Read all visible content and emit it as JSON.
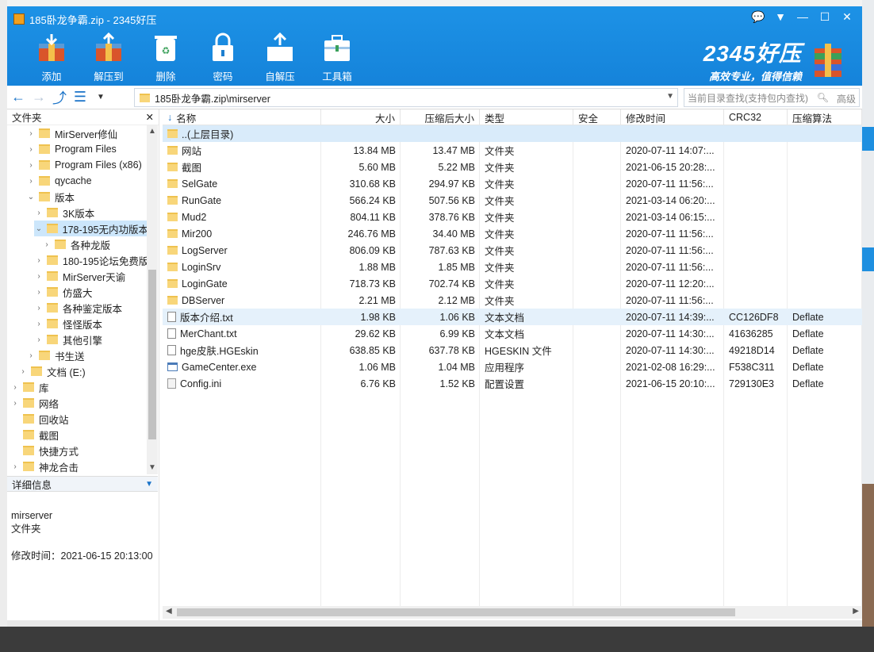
{
  "window": {
    "title": "185卧龙争霸.zip - 2345好压"
  },
  "toolbar": [
    {
      "label": "添加"
    },
    {
      "label": "解压到"
    },
    {
      "label": "删除"
    },
    {
      "label": "密码"
    },
    {
      "label": "自解压"
    },
    {
      "label": "工具箱"
    }
  ],
  "brand": {
    "name": "2345好压",
    "slogan": "高效专业，值得信赖"
  },
  "address": {
    "path": "185卧龙争霸.zip\\mirserver"
  },
  "search": {
    "placeholder": "当前目录查找(支持包内查找)",
    "advanced": "高级"
  },
  "left_pane": {
    "title": "文件夹",
    "tree": [
      {
        "label": "MirServer修仙",
        "level": 3,
        "arrow": "›"
      },
      {
        "label": "Program Files",
        "level": 3,
        "arrow": "›"
      },
      {
        "label": "Program Files (x86)",
        "level": 3,
        "arrow": "›"
      },
      {
        "label": "qycache",
        "level": 3,
        "arrow": "›"
      },
      {
        "label": "版本",
        "level": 3,
        "arrow": "⌄"
      },
      {
        "label": "3K版本",
        "level": 4,
        "arrow": "›"
      },
      {
        "label": "178-195无内功版本",
        "level": 4,
        "arrow": "⌄",
        "selected": true
      },
      {
        "label": "各种龙版",
        "level": 5,
        "arrow": "›"
      },
      {
        "label": "180-195论坛免费版",
        "level": 4,
        "arrow": "›"
      },
      {
        "label": "MirServer天谕",
        "level": 4,
        "arrow": "›"
      },
      {
        "label": "仿盛大",
        "level": 4,
        "arrow": "›"
      },
      {
        "label": "各种鉴定版本",
        "level": 4,
        "arrow": "›"
      },
      {
        "label": "怪怪版本",
        "level": 4,
        "arrow": "›"
      },
      {
        "label": "其他引擎",
        "level": 4,
        "arrow": "›"
      },
      {
        "label": "书生送",
        "level": 3,
        "arrow": "›"
      },
      {
        "label": "文档 (E:)",
        "level": 2,
        "arrow": "›"
      },
      {
        "label": "库",
        "level": 1,
        "arrow": "›"
      },
      {
        "label": "网络",
        "level": 1,
        "arrow": "›"
      },
      {
        "label": "回收站",
        "level": 1,
        "arrow": ""
      },
      {
        "label": "截图",
        "level": 1,
        "arrow": ""
      },
      {
        "label": "快捷方式",
        "level": 1,
        "arrow": ""
      },
      {
        "label": "神龙合击",
        "level": 1,
        "arrow": "›"
      }
    ],
    "detail_title": "详细信息",
    "detail_name": "mirserver",
    "detail_type": "文件夹",
    "detail_modified": "修改时间：2021-06-15 20:13:00"
  },
  "columns": [
    "名称",
    "大小",
    "压缩后大小",
    "类型",
    "安全",
    "修改时间",
    "CRC32",
    "压缩算法"
  ],
  "files": [
    {
      "name": "..(上层目录)",
      "size": "",
      "packed": "",
      "type": "",
      "time": "",
      "crc": "",
      "method": "",
      "icon": "folder"
    },
    {
      "name": "网站",
      "size": "13.84 MB",
      "packed": "13.47 MB",
      "type": "文件夹",
      "time": "2020-07-11 14:07:...",
      "crc": "",
      "method": "",
      "icon": "folder"
    },
    {
      "name": "截图",
      "size": "5.60 MB",
      "packed": "5.22 MB",
      "type": "文件夹",
      "time": "2021-06-15 20:28:...",
      "crc": "",
      "method": "",
      "icon": "folder"
    },
    {
      "name": "SelGate",
      "size": "310.68 KB",
      "packed": "294.97 KB",
      "type": "文件夹",
      "time": "2020-07-11 11:56:...",
      "crc": "",
      "method": "",
      "icon": "folder"
    },
    {
      "name": "RunGate",
      "size": "566.24 KB",
      "packed": "507.56 KB",
      "type": "文件夹",
      "time": "2021-03-14 06:20:...",
      "crc": "",
      "method": "",
      "icon": "folder"
    },
    {
      "name": "Mud2",
      "size": "804.11 KB",
      "packed": "378.76 KB",
      "type": "文件夹",
      "time": "2021-03-14 06:15:...",
      "crc": "",
      "method": "",
      "icon": "folder"
    },
    {
      "name": "Mir200",
      "size": "246.76 MB",
      "packed": "34.40 MB",
      "type": "文件夹",
      "time": "2020-07-11 11:56:...",
      "crc": "",
      "method": "",
      "icon": "folder"
    },
    {
      "name": "LogServer",
      "size": "806.09 KB",
      "packed": "787.63 KB",
      "type": "文件夹",
      "time": "2020-07-11 11:56:...",
      "crc": "",
      "method": "",
      "icon": "folder"
    },
    {
      "name": "LoginSrv",
      "size": "1.88 MB",
      "packed": "1.85 MB",
      "type": "文件夹",
      "time": "2020-07-11 11:56:...",
      "crc": "",
      "method": "",
      "icon": "folder"
    },
    {
      "name": "LoginGate",
      "size": "718.73 KB",
      "packed": "702.74 KB",
      "type": "文件夹",
      "time": "2020-07-11 12:20:...",
      "crc": "",
      "method": "",
      "icon": "folder"
    },
    {
      "name": "DBServer",
      "size": "2.21 MB",
      "packed": "2.12 MB",
      "type": "文件夹",
      "time": "2020-07-11 11:56:...",
      "crc": "",
      "method": "",
      "icon": "folder"
    },
    {
      "name": "版本介绍.txt",
      "size": "1.98 KB",
      "packed": "1.06 KB",
      "type": "文本文档",
      "time": "2020-07-11 14:39:...",
      "crc": "CC126DF8",
      "method": "Deflate",
      "icon": "doc",
      "highlight": true
    },
    {
      "name": "MerChant.txt",
      "size": "29.62 KB",
      "packed": "6.99 KB",
      "type": "文本文档",
      "time": "2020-07-11 14:30:...",
      "crc": "41636285",
      "method": "Deflate",
      "icon": "doc"
    },
    {
      "name": "hge皮肤.HGEskin",
      "size": "638.85 KB",
      "packed": "637.78 KB",
      "type": "HGESKIN 文件",
      "time": "2020-07-11 14:30:...",
      "crc": "49218D14",
      "method": "Deflate",
      "icon": "doc"
    },
    {
      "name": "GameCenter.exe",
      "size": "1.06 MB",
      "packed": "1.04 MB",
      "type": "应用程序",
      "time": "2021-02-08 16:29:...",
      "crc": "F538C311",
      "method": "Deflate",
      "icon": "exe"
    },
    {
      "name": "Config.ini",
      "size": "6.76 KB",
      "packed": "1.52 KB",
      "type": "配置设置",
      "time": "2021-06-15 20:10:...",
      "crc": "729130E3",
      "method": "Deflate",
      "icon": "ini"
    }
  ],
  "colors": {
    "titlebar": "#1d92e6",
    "selection": "#cce6fb",
    "row_highlight": "#e5f1fb"
  }
}
